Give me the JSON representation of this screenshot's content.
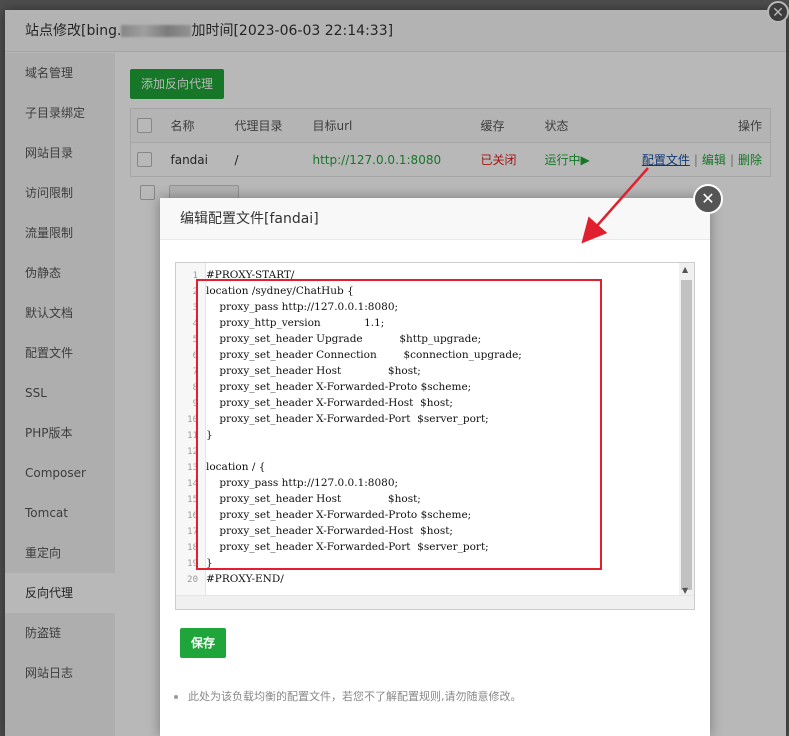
{
  "window": {
    "title_prefix": "站点修改[bing.",
    "title_suffix": "加时间[2023-06-03 22:14:33]",
    "close_symbol": "✕"
  },
  "sidebar": {
    "items": [
      {
        "label": "域名管理"
      },
      {
        "label": "子目录绑定"
      },
      {
        "label": "网站目录"
      },
      {
        "label": "访问限制"
      },
      {
        "label": "流量限制"
      },
      {
        "label": "伪静态"
      },
      {
        "label": "默认文档"
      },
      {
        "label": "配置文件"
      },
      {
        "label": "SSL"
      },
      {
        "label": "PHP版本"
      },
      {
        "label": "Composer"
      },
      {
        "label": "Tomcat"
      },
      {
        "label": "重定向"
      },
      {
        "label": "反向代理"
      },
      {
        "label": "防盗链"
      },
      {
        "label": "网站日志"
      }
    ],
    "active_index": 13
  },
  "main": {
    "add_button": "添加反向代理",
    "table": {
      "headers": [
        "名称",
        "代理目录",
        "目标url",
        "缓存",
        "状态",
        "操作"
      ],
      "rows": [
        {
          "name": "fandai",
          "dir": "/",
          "url": "http://127.0.0.1:8080",
          "cache": "已关闭",
          "status": "运行中▶",
          "actions": [
            "配置文件",
            "编辑",
            "删除"
          ]
        }
      ],
      "separator": "|"
    }
  },
  "editor_modal": {
    "title": "编辑配置文件[fandai]",
    "close_symbol": "✕",
    "code": [
      {
        "n": "1",
        "t": "#PROXY-START/"
      },
      {
        "n": "2",
        "t": "location /sydney/ChatHub {"
      },
      {
        "n": "3",
        "t": "    proxy_pass http://127.0.0.1:8080;"
      },
      {
        "n": "4",
        "t": "    proxy_http_version             1.1;"
      },
      {
        "n": "5",
        "t": "    proxy_set_header Upgrade           $http_upgrade;"
      },
      {
        "n": "6",
        "t": "    proxy_set_header Connection        $connection_upgrade;"
      },
      {
        "n": "7",
        "t": "    proxy_set_header Host              $host;"
      },
      {
        "n": "8",
        "t": "    proxy_set_header X-Forwarded-Proto $scheme;"
      },
      {
        "n": "9",
        "t": "    proxy_set_header X-Forwarded-Host  $host;"
      },
      {
        "n": "10",
        "t": "    proxy_set_header X-Forwarded-Port  $server_port;"
      },
      {
        "n": "11",
        "t": "}"
      },
      {
        "n": "12",
        "t": ""
      },
      {
        "n": "13",
        "t": "location / {"
      },
      {
        "n": "14",
        "t": "    proxy_pass http://127.0.0.1:8080;"
      },
      {
        "n": "15",
        "t": "    proxy_set_header Host              $host;"
      },
      {
        "n": "16",
        "t": "    proxy_set_header X-Forwarded-Proto $scheme;"
      },
      {
        "n": "17",
        "t": "    proxy_set_header X-Forwarded-Host  $host;"
      },
      {
        "n": "18",
        "t": "    proxy_set_header X-Forwarded-Port  $server_port;"
      },
      {
        "n": "19",
        "t": "}"
      },
      {
        "n": "20",
        "t": "#PROXY-END/"
      }
    ],
    "save_button": "保存",
    "tip": "此处为该负载均衡的配置文件，若您不了解配置规则,请勿随意修改。"
  },
  "colors": {
    "accent_green": "#20a53a",
    "status_red": "#e02020",
    "annotation_red": "#e0202e"
  }
}
